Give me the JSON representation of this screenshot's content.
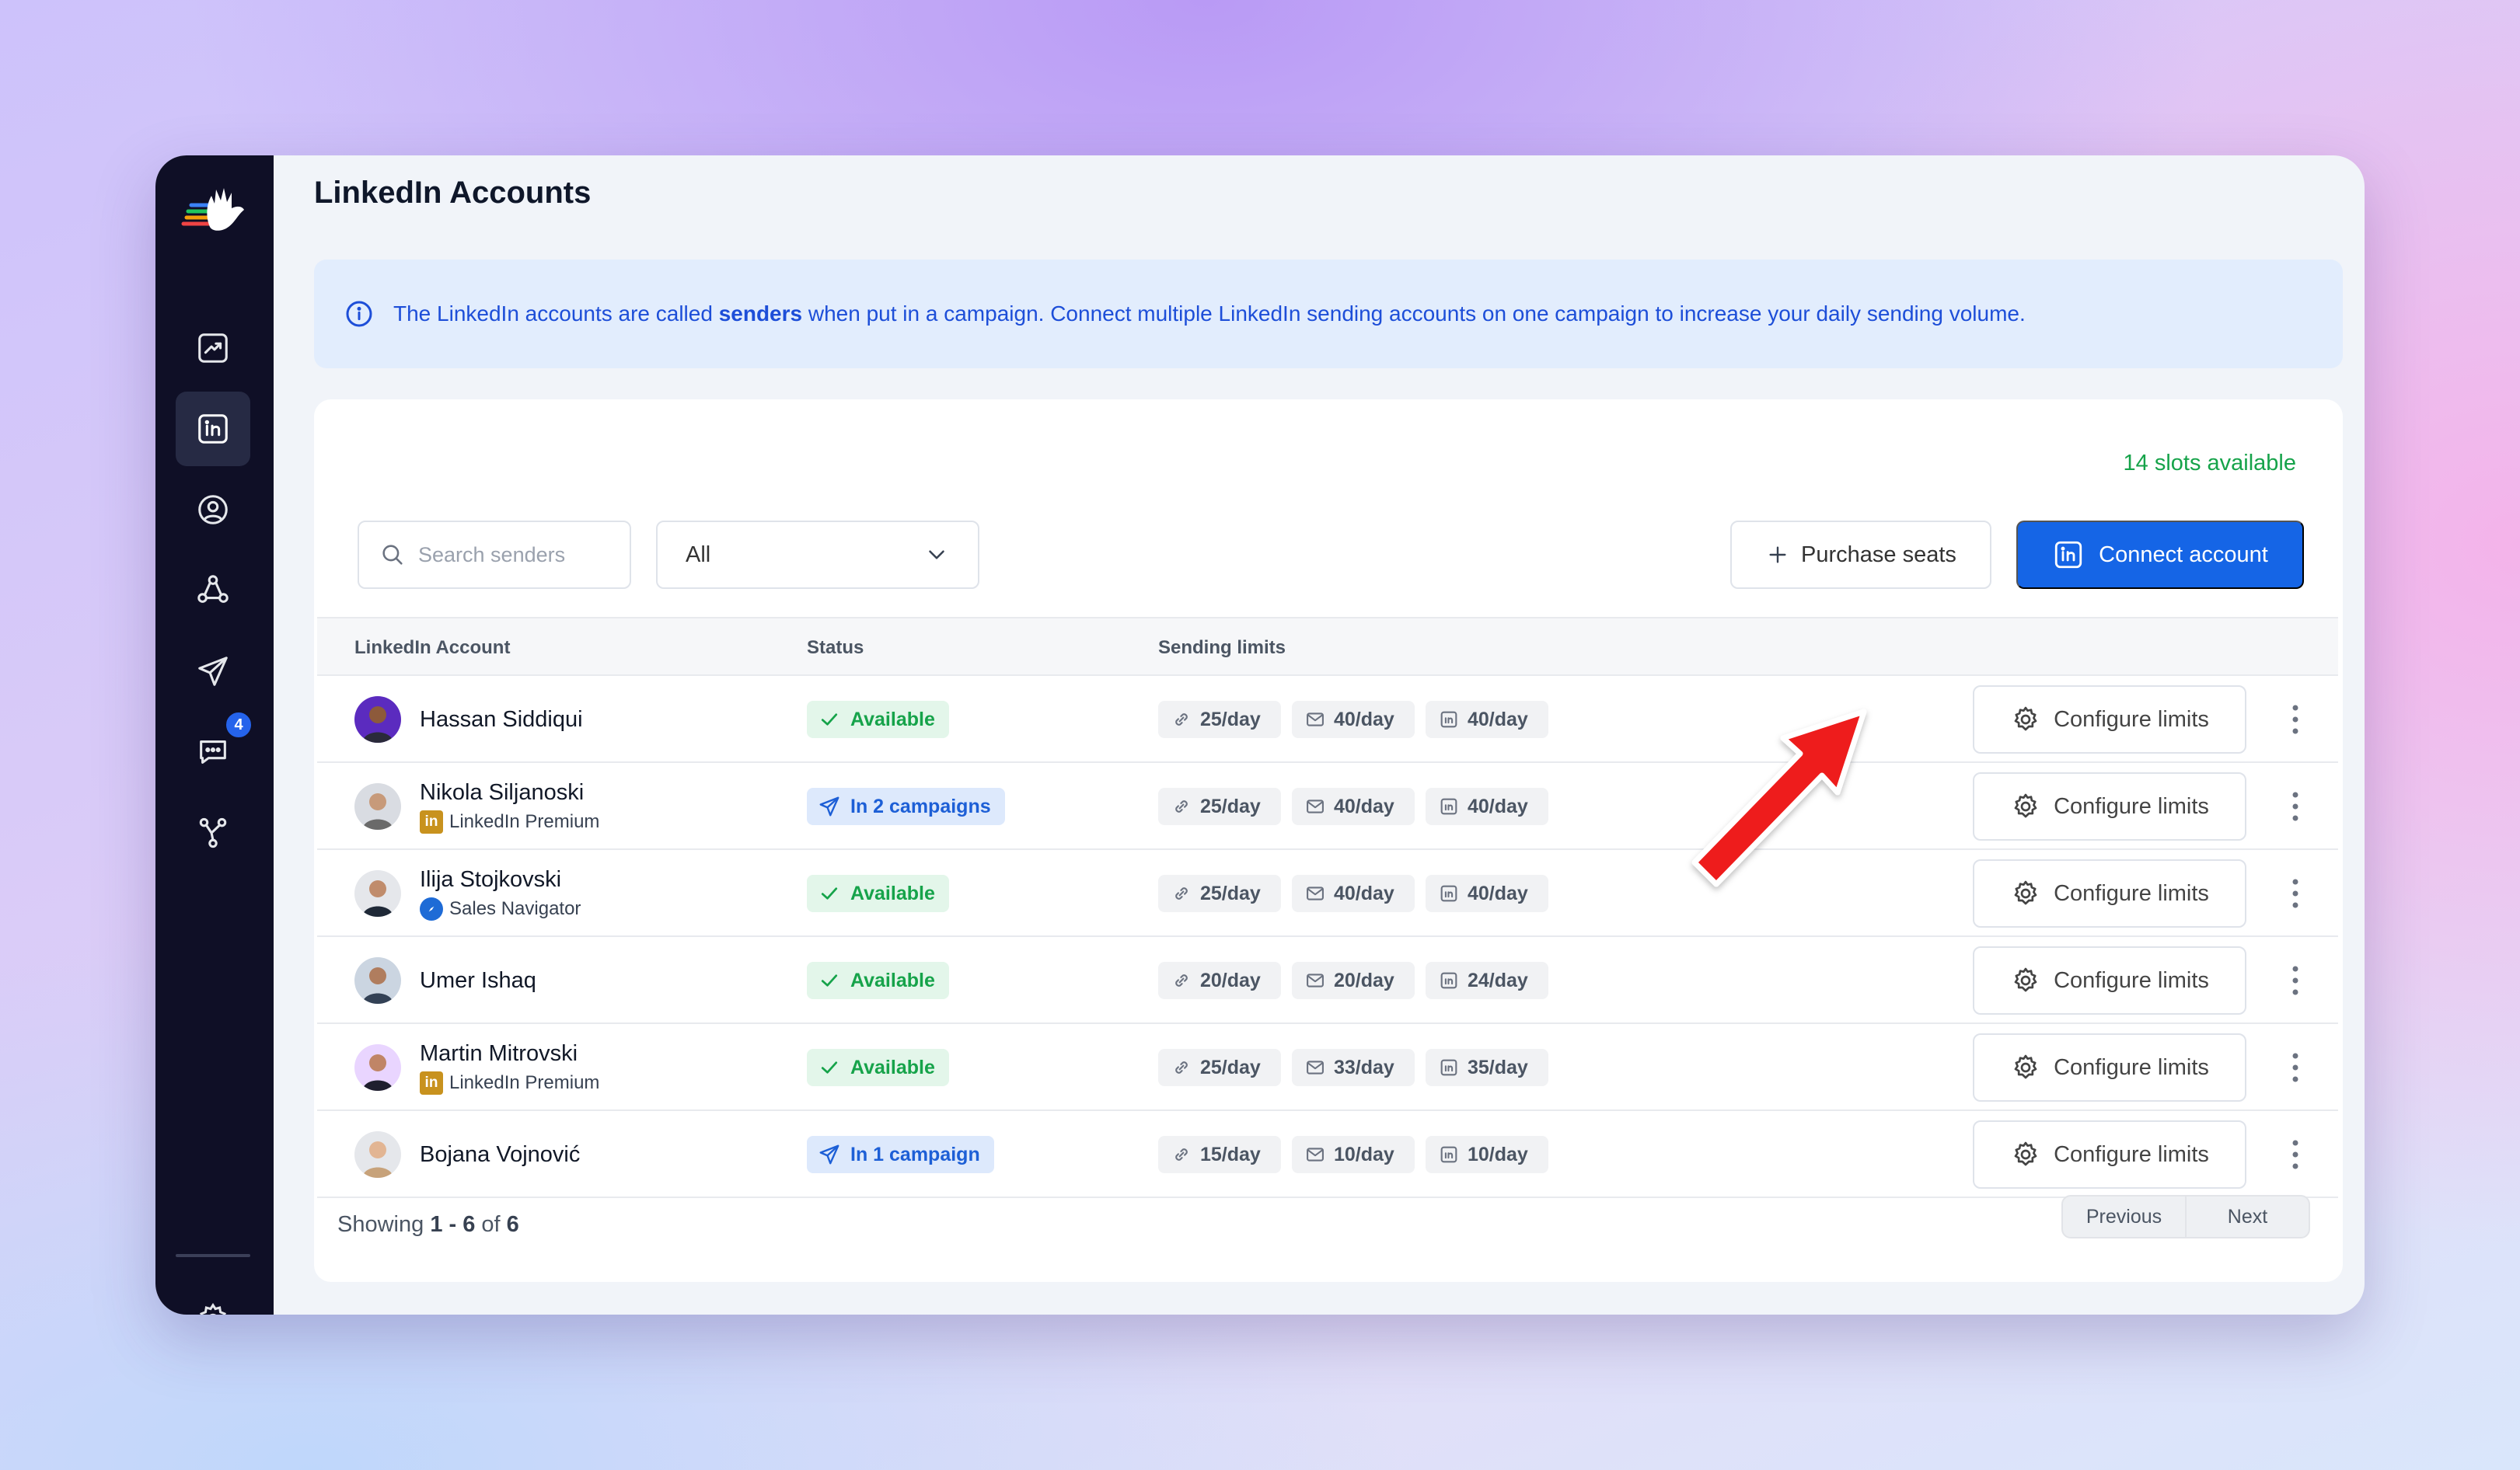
{
  "page": {
    "title": "LinkedIn Accounts"
  },
  "banner": {
    "text_before": "The LinkedIn accounts are called ",
    "text_bold": "senders",
    "text_after": " when put in a campaign. Connect multiple LinkedIn sending accounts on one campaign to increase your daily sending volume."
  },
  "sidebar": {
    "items": [
      {
        "icon": "chart-icon"
      },
      {
        "icon": "linkedin-icon",
        "active": true
      },
      {
        "icon": "user-circle-icon"
      },
      {
        "icon": "network-icon"
      },
      {
        "icon": "send-icon"
      },
      {
        "icon": "chat-icon",
        "badge": "4"
      },
      {
        "icon": "integrations-icon"
      },
      {
        "icon": "gear-icon"
      }
    ]
  },
  "toolbar": {
    "slots": "14 slots available",
    "search_placeholder": "Search senders",
    "filter_value": "All",
    "purchase_label": "Purchase seats",
    "connect_label": "Connect account"
  },
  "table": {
    "headers": {
      "account": "LinkedIn Account",
      "status": "Status",
      "limits": "Sending limits"
    },
    "configure_label": "Configure limits",
    "rows": [
      {
        "name": "Hassan Siddiqui",
        "sub": "",
        "status": "Available",
        "status_type": "available",
        "connect": "25/day",
        "message": "40/day",
        "inmail": "40/day"
      },
      {
        "name": "Nikola Siljanoski",
        "sub": "LinkedIn Premium",
        "sub_type": "premium",
        "status": "In 2 campaigns",
        "status_type": "campaign",
        "connect": "25/day",
        "message": "40/day",
        "inmail": "40/day"
      },
      {
        "name": "Ilija Stojkovski",
        "sub": "Sales Navigator",
        "sub_type": "navigator",
        "status": "Available",
        "status_type": "available",
        "connect": "25/day",
        "message": "40/day",
        "inmail": "40/day"
      },
      {
        "name": "Umer Ishaq",
        "sub": "",
        "status": "Available",
        "status_type": "available",
        "connect": "20/day",
        "message": "20/day",
        "inmail": "24/day"
      },
      {
        "name": "Martin Mitrovski",
        "sub": "LinkedIn Premium",
        "sub_type": "premium",
        "status": "Available",
        "status_type": "available",
        "connect": "25/day",
        "message": "33/day",
        "inmail": "35/day"
      },
      {
        "name": "Bojana Vojnović",
        "sub": "",
        "status": "In 1 campaign",
        "status_type": "campaign",
        "connect": "15/day",
        "message": "10/day",
        "inmail": "10/day"
      }
    ]
  },
  "pagination": {
    "showing_prefix": "Showing ",
    "range": "1 - 6",
    "of": " of ",
    "total": "6",
    "previous": "Previous",
    "next": "Next"
  },
  "colors": {
    "accent": "#1565e6",
    "available": "#16a34a",
    "annotation_arrow": "#ee1c1c"
  }
}
